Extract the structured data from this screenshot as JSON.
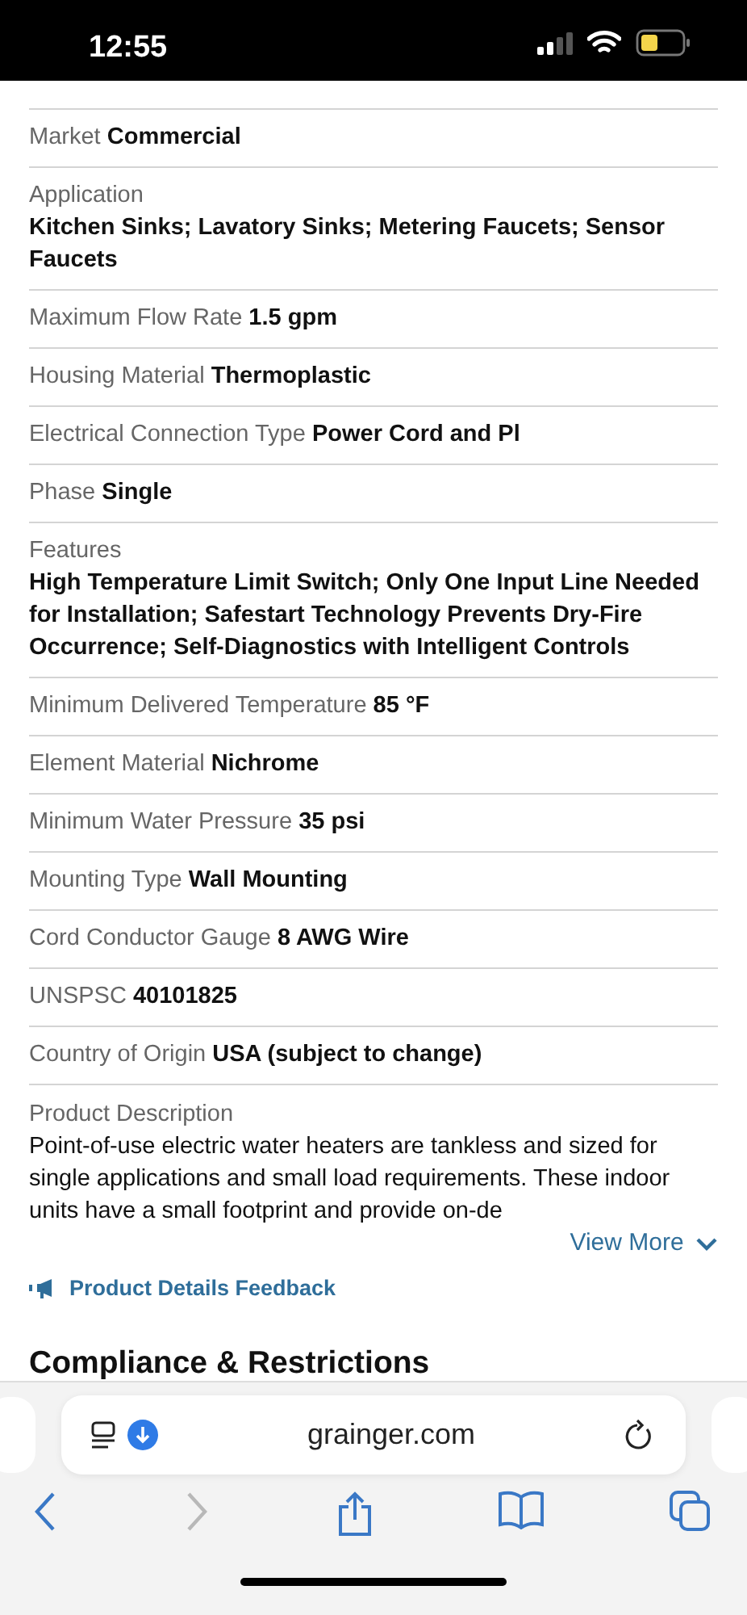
{
  "status_bar": {
    "time": "12:55"
  },
  "specs": [
    {
      "kind": "inline",
      "label": "Market",
      "value": "Commercial"
    },
    {
      "kind": "stacked",
      "label": "Application",
      "value": "Kitchen Sinks; Lavatory Sinks; Metering Faucets; Sensor Faucets"
    },
    {
      "kind": "inline",
      "label": "Maximum Flow Rate",
      "value": "1.5 gpm"
    },
    {
      "kind": "inline",
      "label": "Housing Material",
      "value": "Thermoplastic"
    },
    {
      "kind": "inline",
      "label": "Electrical Connection Type",
      "value": "Power Cord and Pl"
    },
    {
      "kind": "inline",
      "label": "Phase",
      "value": "Single"
    },
    {
      "kind": "stacked",
      "label": "Features",
      "value": "High Temperature Limit Switch; Only One Input Line Needed for Installation; Safestart Technology Prevents Dry-Fire Occurrence; Self-Diagnostics with Intelligent Controls"
    },
    {
      "kind": "inline",
      "label": "Minimum Delivered Temperature",
      "value": "85 °F"
    },
    {
      "kind": "inline",
      "label": "Element Material",
      "value": "Nichrome"
    },
    {
      "kind": "inline",
      "label": "Minimum Water Pressure",
      "value": "35 psi"
    },
    {
      "kind": "inline",
      "label": "Mounting Type",
      "value": "Wall Mounting"
    },
    {
      "kind": "inline",
      "label": "Cord Conductor Gauge",
      "value": "8 AWG Wire"
    },
    {
      "kind": "inline",
      "label": "UNSPSC",
      "value": "40101825"
    },
    {
      "kind": "inline",
      "label": "Country of Origin",
      "value": "USA (subject to change)"
    }
  ],
  "description": {
    "label": "Product Description",
    "text": "Point-of-use electric water heaters are tankless and sized for single applications and small load requirements. These indoor units have a small footprint and provide on-de",
    "more": "View More"
  },
  "feedback": "Product Details Feedback",
  "heading": "Compliance & Restrictions",
  "browser": {
    "url": "grainger.com",
    "back_disabled": false,
    "forward_disabled": true
  }
}
